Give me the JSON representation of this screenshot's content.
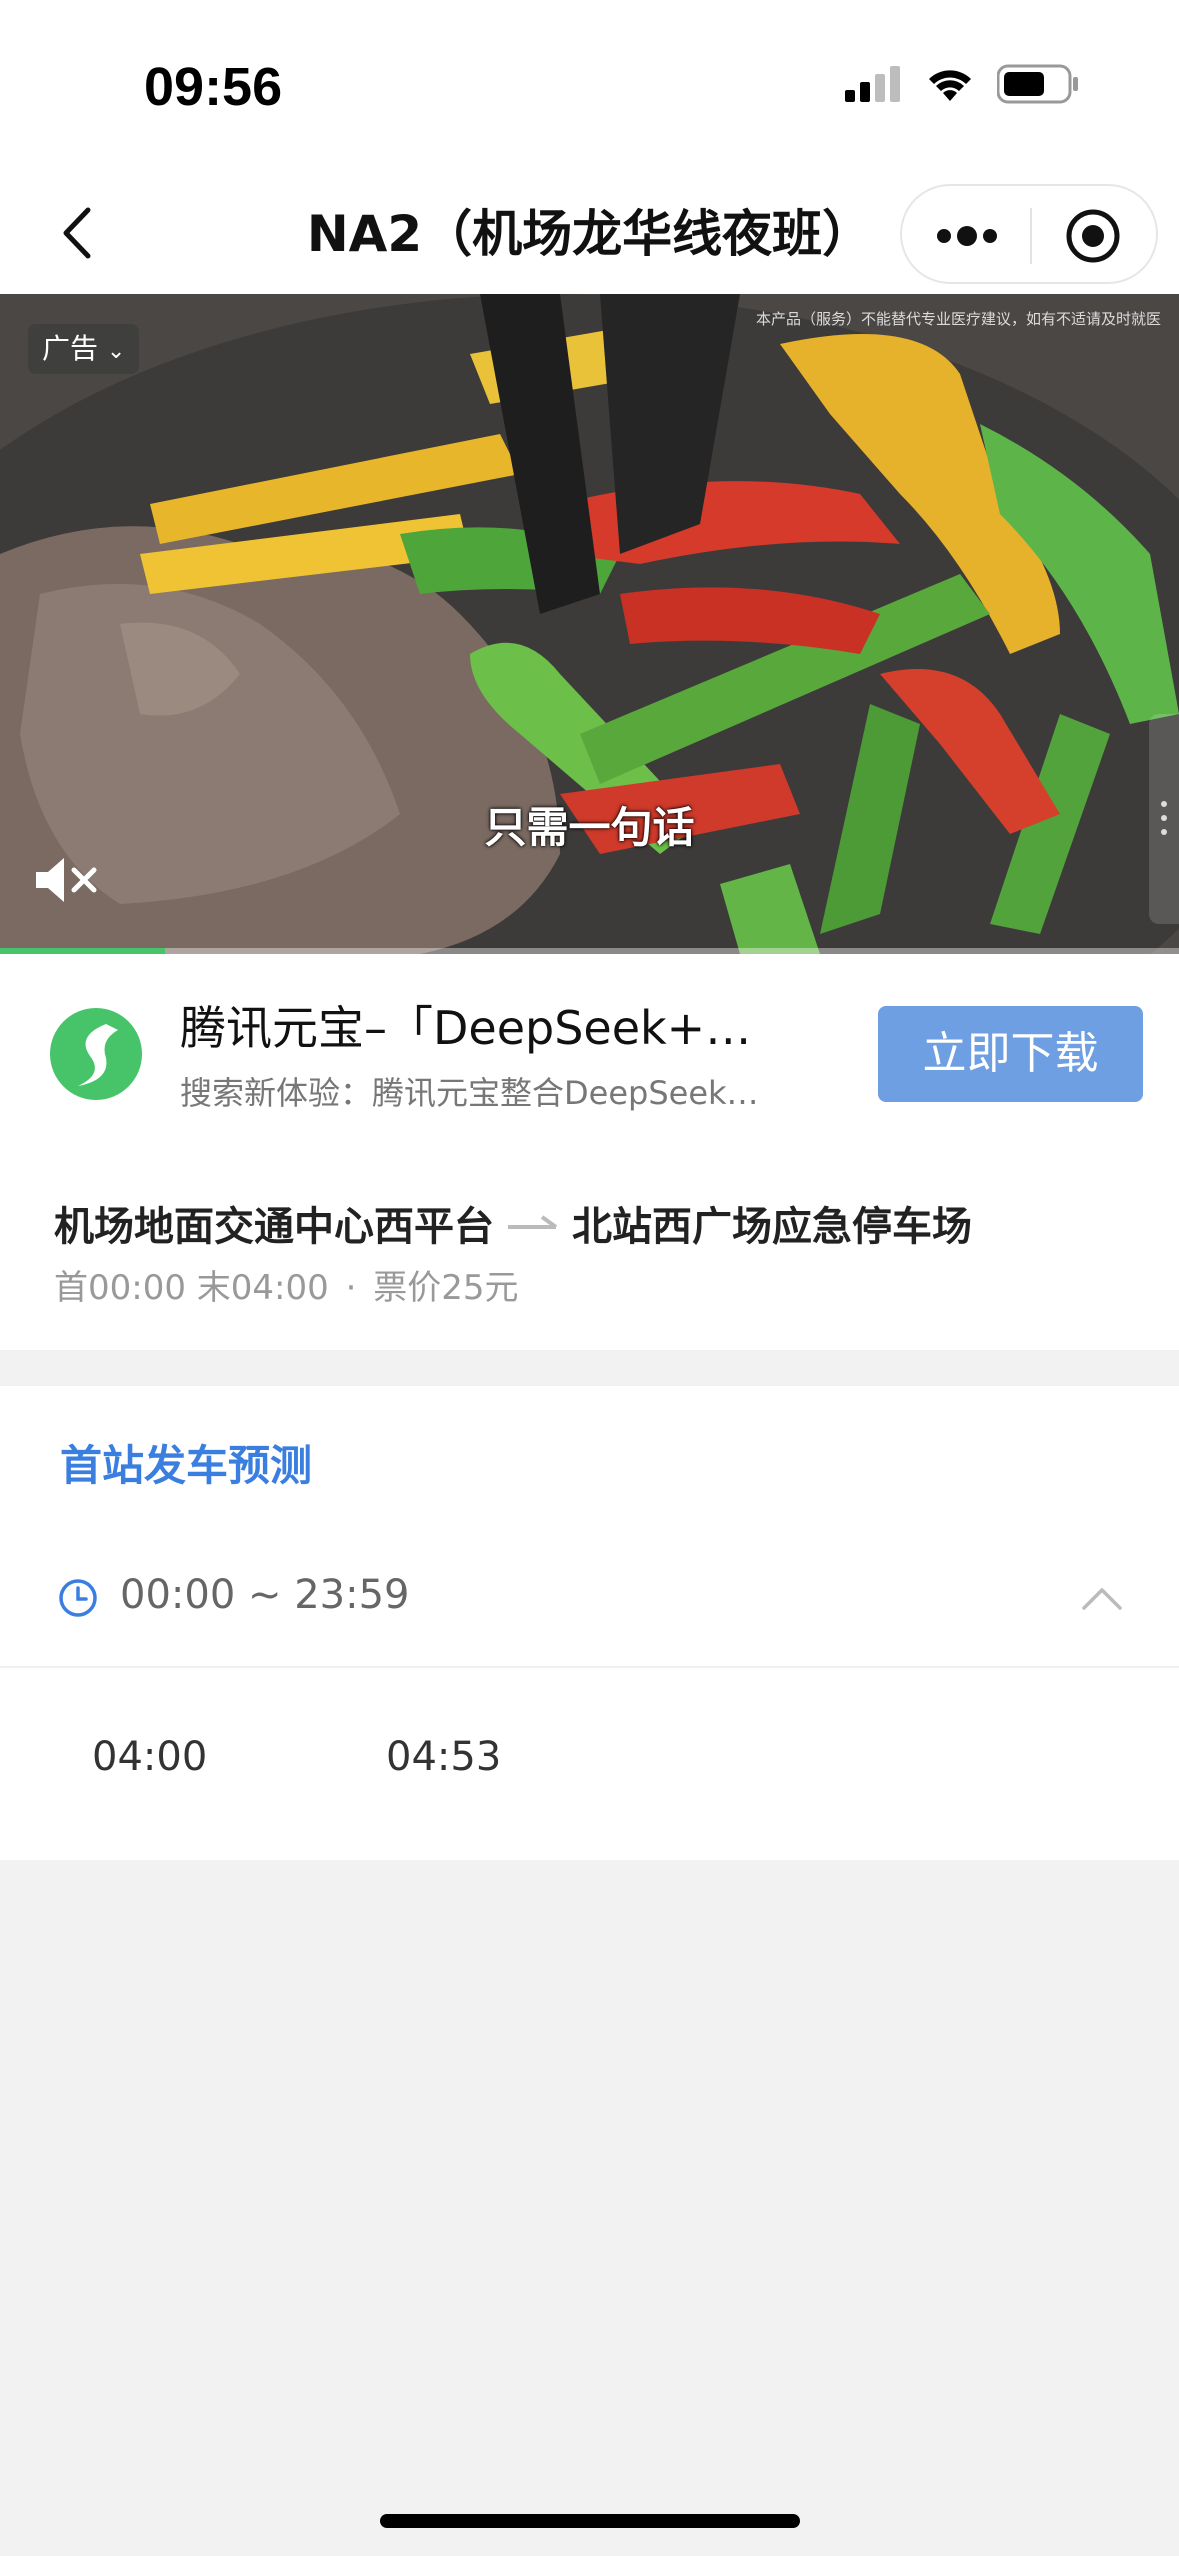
{
  "status_bar": {
    "time": "09:56",
    "icons": [
      "cellular-signal-icon",
      "wifi-icon",
      "battery-icon"
    ]
  },
  "nav": {
    "title": "NA2（机场龙华线夜班）",
    "icons": [
      "back-icon",
      "more-icon",
      "target-icon"
    ]
  },
  "ad": {
    "badge": "广告",
    "disclaimer": "本产品（服务）不能替代专业医疗建议，如有不适请及时就医",
    "caption": "只需一句话",
    "progress_fraction": 0.14,
    "app_name": "腾讯元宝–「DeepSeek+…",
    "app_desc": "搜索新体验：腾讯元宝整合DeepSeek…",
    "download_label": "立即下载",
    "colors": {
      "download": "#6e9fe2",
      "logo": "#47c46a",
      "progress": "#47c46a"
    }
  },
  "route": {
    "from": "机场地面交通中心西平台",
    "to": "北站西广场应急停车场",
    "first_bus": "首00:00",
    "last_bus": "末04:00",
    "separator": "·",
    "fare": "票价25元"
  },
  "prediction": {
    "title": "首站发车预测",
    "time_range": "00:00 ~ 23:59",
    "departures": [
      "04:00",
      "04:53"
    ],
    "accent_color": "#3a7ee0"
  }
}
